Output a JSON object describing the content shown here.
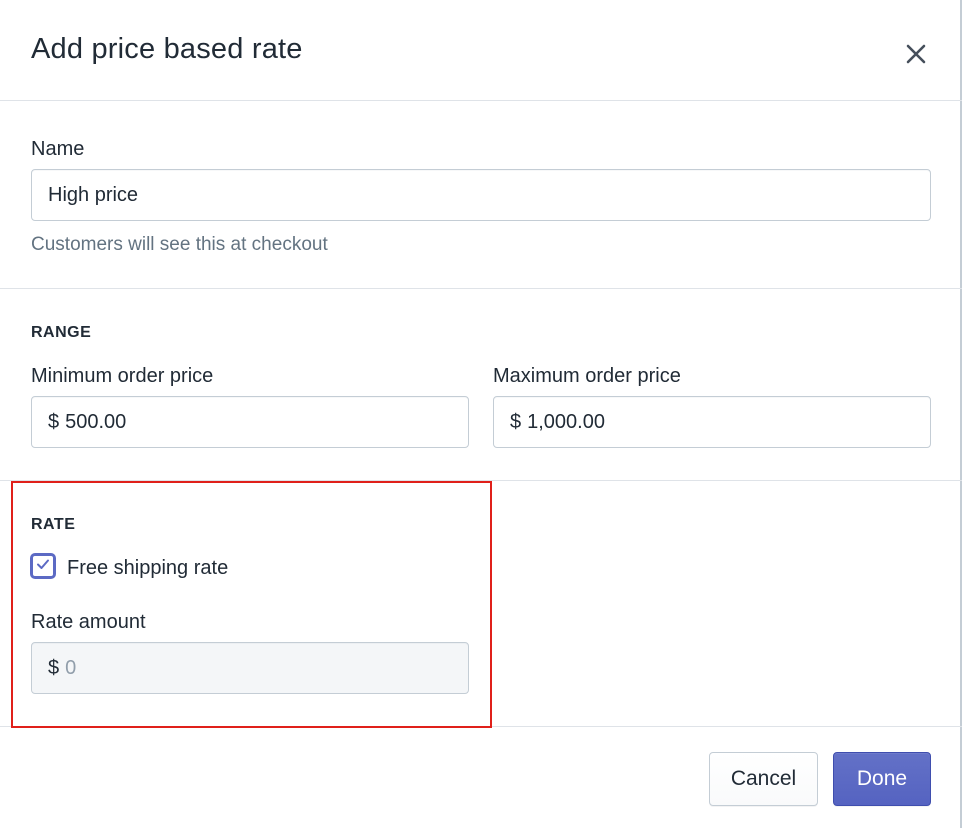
{
  "modal": {
    "title": "Add price based rate",
    "close_icon": "close-icon"
  },
  "name_section": {
    "label": "Name",
    "value": "High price",
    "help_text": "Customers will see this at checkout"
  },
  "range_section": {
    "heading": "RANGE",
    "min": {
      "label": "Minimum order price",
      "prefix": "$",
      "value": "500.00"
    },
    "max": {
      "label": "Maximum order price",
      "prefix": "$",
      "value": "1,000.00"
    }
  },
  "rate_section": {
    "heading": "RATE",
    "free_shipping": {
      "label": "Free shipping rate",
      "checked": true
    },
    "amount": {
      "label": "Rate amount",
      "prefix": "$",
      "placeholder": "0",
      "disabled": true
    }
  },
  "footer": {
    "cancel_label": "Cancel",
    "done_label": "Done"
  },
  "colors": {
    "primary": "#5c6ac4",
    "text": "#212b36",
    "subdued_text": "#637381",
    "border": "#c4cdd5",
    "annotation": "#e0201a"
  }
}
